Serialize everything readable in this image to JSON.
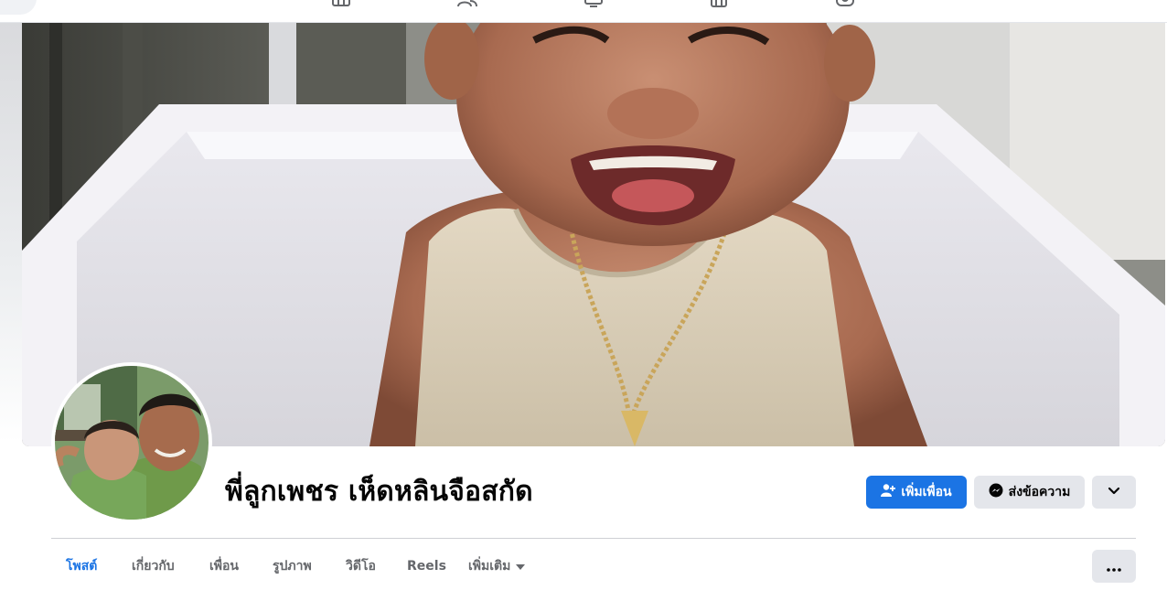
{
  "profile": {
    "name": "พี่ลูกเพชร เห็ดหลินจือสกัด"
  },
  "actions": {
    "add_friend_label": "เพิ่มเพื่อน",
    "message_label": "ส่งข้อความ"
  },
  "tabs": [
    {
      "label": "โพสต์",
      "active": true
    },
    {
      "label": "เกี่ยวกับ",
      "active": false
    },
    {
      "label": "เพื่อน",
      "active": false
    },
    {
      "label": "รูปภาพ",
      "active": false
    },
    {
      "label": "วิดีโอ",
      "active": false
    },
    {
      "label": "Reels",
      "active": false
    },
    {
      "label": "เพิ่มเติม",
      "active": false
    }
  ],
  "top_nav_icons": [
    "home-icon",
    "friends-icon",
    "watch-icon",
    "marketplace-icon",
    "groups-icon"
  ],
  "colors": {
    "accent": "#1b74e4",
    "button_gray": "#e4e6eb",
    "text_primary": "#050505",
    "text_secondary": "#65676b",
    "divider": "#ced0d4"
  }
}
